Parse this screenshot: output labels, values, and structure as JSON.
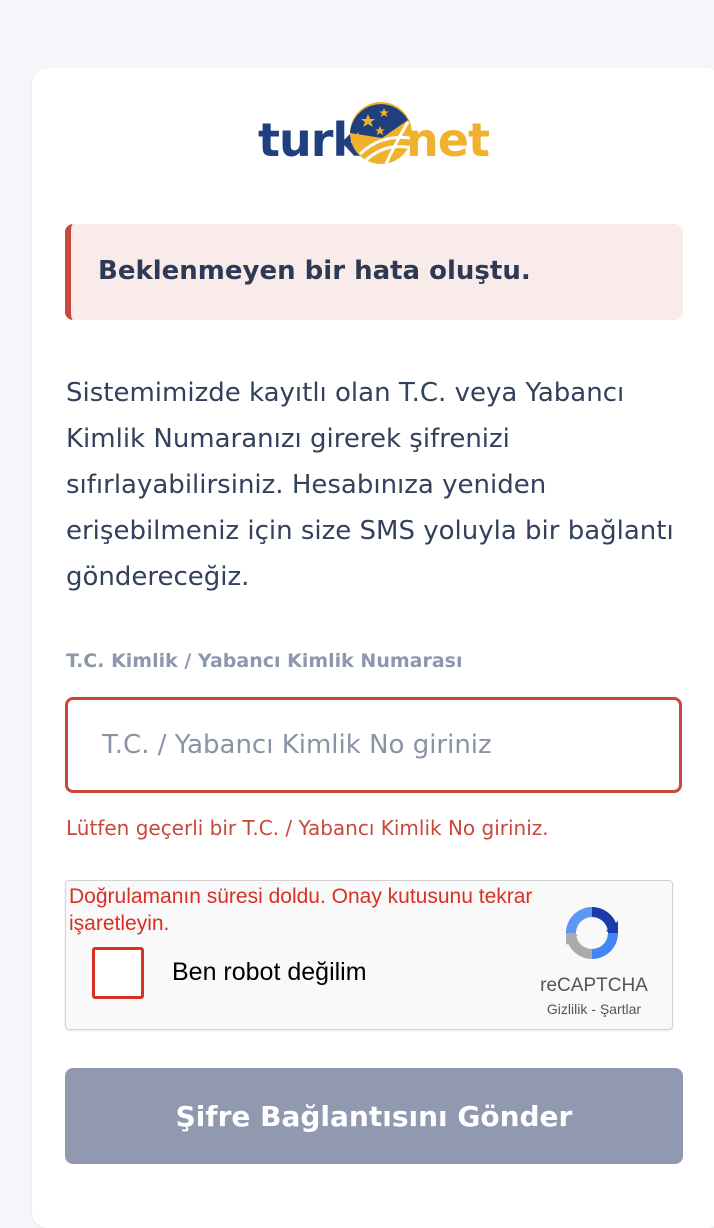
{
  "brand": {
    "logo_part1": "turk",
    "logo_part2": "net",
    "primary_color": "#1f3f7f",
    "accent_color": "#f0b22c"
  },
  "alert": {
    "message": "Beklenmeyen bir hata oluştu.",
    "color": "#c9483c"
  },
  "description": "Sistemimizde kayıtlı olan T.C. veya Yabancı Kimlik Numaranızı girerek şifrenizi sıfırlayabilirsiniz. Hesabınıza yeniden erişebilmeniz için size SMS yoluyla bir bağlantı göndereceğiz.",
  "form": {
    "id_label": "T.C. Kimlik / Yabancı Kimlik Numarası",
    "id_value": "",
    "id_placeholder": "T.C. / Yabancı Kimlik No giriniz",
    "id_error": "Lütfen geçerli bir T.C. / Yabancı Kimlik No giriniz."
  },
  "recaptcha": {
    "expired_message": "Doğrulamanın süresi doldu. Onay kutusunu tekrar işaretleyin.",
    "checkbox_label": "Ben robot değilim",
    "checked": false,
    "brand": "reCAPTCHA",
    "privacy_link": "Gizlilik",
    "separator": "-",
    "terms_link": "Şartlar",
    "logo_icon": "recaptcha-icon"
  },
  "submit_label": "Şifre Bağlantısını Gönder"
}
